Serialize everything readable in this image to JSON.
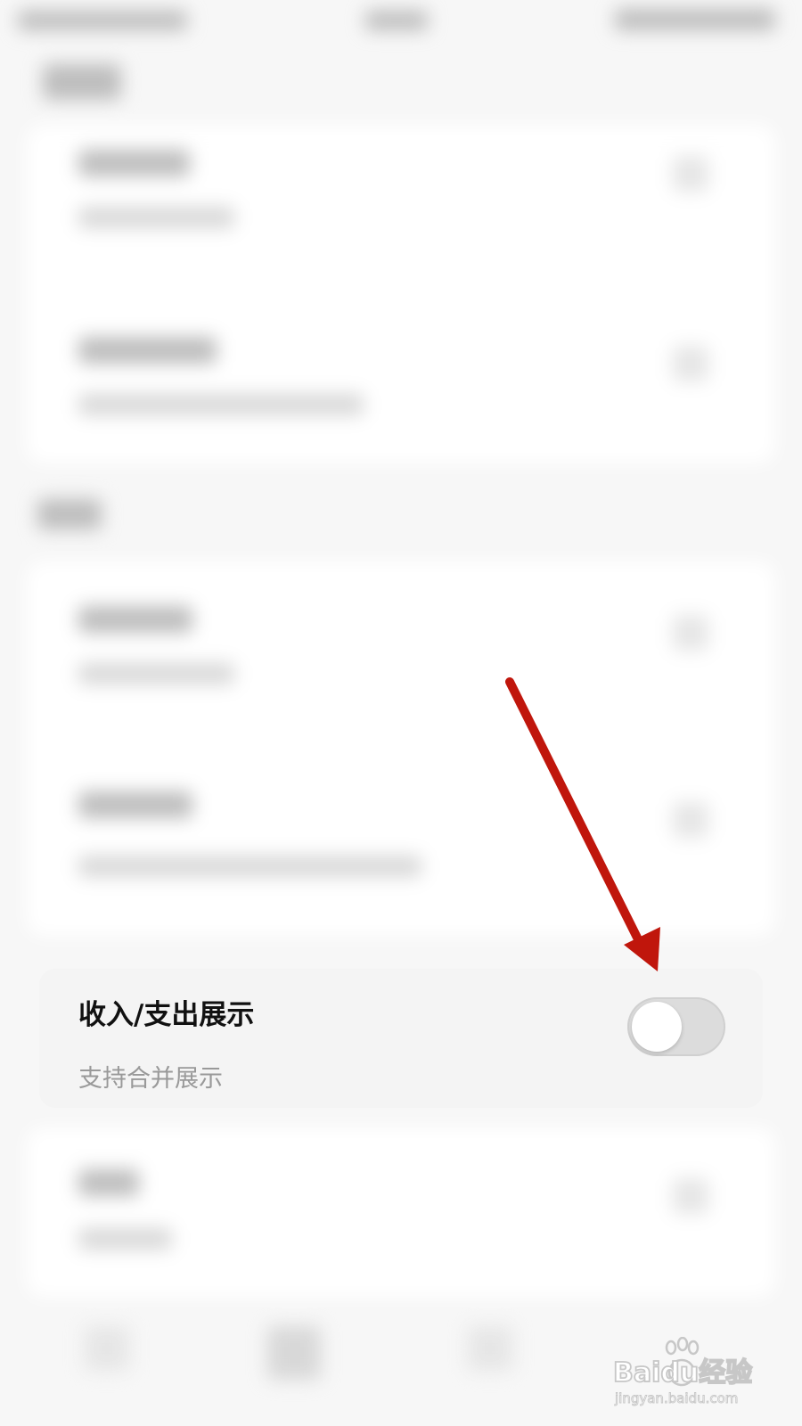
{
  "setting": {
    "title": "收入/支出展示",
    "subtitle": "支持合并展示",
    "toggle_state": "off"
  },
  "watermark": {
    "brand": "Baidu经验",
    "url": "jingyan.baidu.com"
  },
  "colors": {
    "arrow": "#c0160c",
    "toggle_track": "#dcdcdc",
    "toggle_knob": "#ffffff",
    "title_text": "#111111",
    "subtitle_text": "#999999"
  }
}
